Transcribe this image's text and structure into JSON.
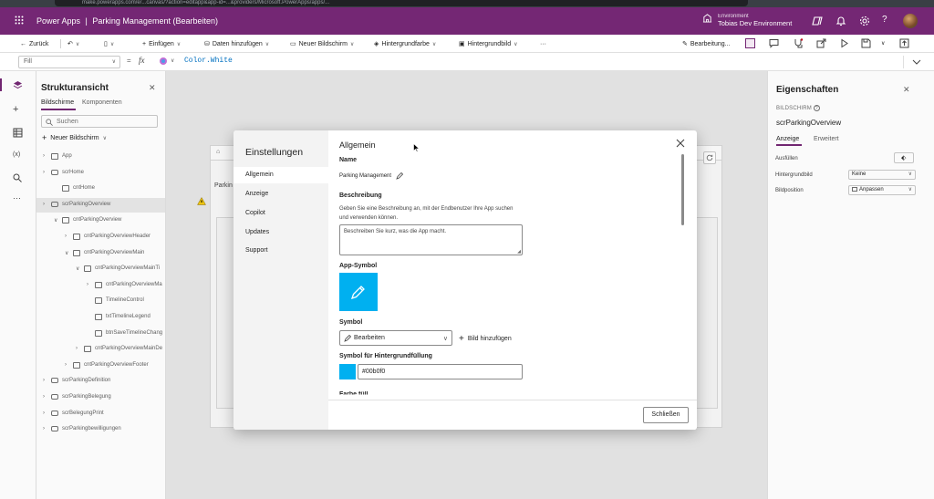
{
  "browser": {
    "url": "make.powerapps.com/e/...canvas/?action=editapp&app-id=...&providers/Microsoft.PowerApps/apps/..."
  },
  "header": {
    "brand": "Power Apps",
    "separator": "|",
    "app_title": "Parking Management (Bearbeiten)",
    "environment_label": "Environment",
    "environment_name": "Tobias Dev Environment"
  },
  "command_bar": {
    "back": "Zurück",
    "insert": "Einfügen",
    "add_data": "Daten hinzufügen",
    "new_screen": "Neuer Bildschirm",
    "background_color": "Hintergrundfarbe",
    "background_image": "Hintergrundbild",
    "more": "···",
    "editing": "Bearbeitung..."
  },
  "formula_bar": {
    "property": "Fill",
    "equals": "=",
    "fx": "fx",
    "formula": "Color.White"
  },
  "tree": {
    "title": "Strukturansicht",
    "tabs": [
      "Bildschirme",
      "Komponenten"
    ],
    "search_placeholder": "Suchen",
    "new_screen": "Neuer Bildschirm",
    "items": [
      {
        "label": "App"
      },
      {
        "label": "scrHome"
      },
      {
        "label": "cntHome"
      },
      {
        "label": "scrParkingOverview"
      },
      {
        "label": "cntParkingOverview"
      },
      {
        "label": "cntParkingOverviewHeader"
      },
      {
        "label": "cntParkingOverviewMain"
      },
      {
        "label": "cntParkingOverviewMainTi"
      },
      {
        "label": "cntParkingOverviewMa"
      },
      {
        "label": "TimelineControl"
      },
      {
        "label": "txtTimelineLegend"
      },
      {
        "label": "btnSaveTimelineChang"
      },
      {
        "label": "cntParkingOverviewMainDe"
      },
      {
        "label": "cntParkingOverviewFooter"
      },
      {
        "label": "scrParkingDefinition"
      },
      {
        "label": "scrParkingBelegung"
      },
      {
        "label": "scrBelegungPrint"
      },
      {
        "label": "scrParkingbewilligungen"
      }
    ]
  },
  "canvas": {
    "partial_label": "Parkin"
  },
  "properties": {
    "title": "Eigenschaften",
    "type": "BILDSCHIRM",
    "name": "scrParkingOverview",
    "tabs": [
      "Anzeige",
      "Erweitert"
    ],
    "rows": [
      {
        "label": "Ausfüllen",
        "value": ""
      },
      {
        "label": "Hintergrundbild",
        "value": "Keine"
      },
      {
        "label": "Bildposition",
        "value": "Anpassen"
      }
    ]
  },
  "dialog": {
    "title": "Einstellungen",
    "nav": [
      "Allgemein",
      "Anzeige",
      "Copilot",
      "Updates",
      "Support"
    ],
    "section_title": "Allgemein",
    "name_label": "Name",
    "name_value": "Parking Management",
    "description_label": "Beschreibung",
    "description_help_1": "Geben Sie eine Beschreibung an, mit der Endbenutzer Ihre App suchen",
    "description_help_2": "und verwenden können.",
    "description_placeholder": "Beschreiben Sie kurz, was die App macht.",
    "app_icon_label": "App-Symbol",
    "symbol_label": "Symbol",
    "symbol_value": "Bearbeiten",
    "add_image": "Bild hinzufügen",
    "bg_fill_label": "Symbol für Hintergrundfüllung",
    "bg_fill_value": "#00b0f0",
    "next_label_cut": "Farbe füll",
    "close_button": "Schließen"
  },
  "colors": {
    "brand": "#742774",
    "icon_fill": "#00b0f0",
    "formula_text": "#0070c0"
  }
}
